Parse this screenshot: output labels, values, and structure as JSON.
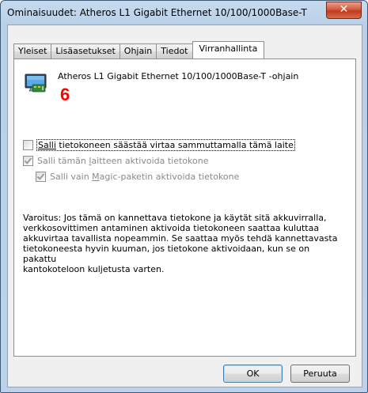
{
  "window": {
    "title": "Ominaisuudet: Atheros L1 Gigabit Ethernet 10/100/1000Base-T ...",
    "close_glyph": "✕"
  },
  "tabs": [
    {
      "label": "Yleiset",
      "active": false
    },
    {
      "label": "Lisäasetukset",
      "active": false
    },
    {
      "label": "Ohjain",
      "active": false
    },
    {
      "label": "Tiedot",
      "active": false
    },
    {
      "label": "Virranhallinta",
      "active": true
    }
  ],
  "device": {
    "icon": "network-adapter-icon",
    "name": "Atheros L1 Gigabit Ethernet 10/100/1000Base-T -ohjain"
  },
  "annotation": {
    "text": "6",
    "color": "#ff0000"
  },
  "options": {
    "allow_power_off": {
      "prefix": "Salli",
      "rest": " tietokoneen säästää virtaa sammuttamalla tämä laite",
      "checked": false,
      "enabled": true
    },
    "allow_wake": {
      "prefix": "Salli tämän ",
      "mnemonic": "l",
      "rest": "aitteen aktivoida tietokone",
      "checked": true,
      "enabled": false
    },
    "magic_packet_only": {
      "prefix": "Salli vain ",
      "mnemonic": "M",
      "rest": "agic-paketin aktivoida tietokone",
      "checked": true,
      "enabled": false
    }
  },
  "warning_text": "Varoitus: Jos tämä on kannettava tietokone ja käytät sitä akkuvirralla,\nverkkosovittimen antaminen aktivoida tietokoneen saattaa kuluttaa\nakkuvirtaa tavallista nopeammin. Se saattaa myös tehdä kannettavasta\ntietokoneesta hyvin kuuman, jos tietokone aktivoidaan, kun se on pakattu\nkantokoteloon kuljetusta varten.",
  "buttons": {
    "ok": "OK",
    "cancel": "Peruuta"
  }
}
